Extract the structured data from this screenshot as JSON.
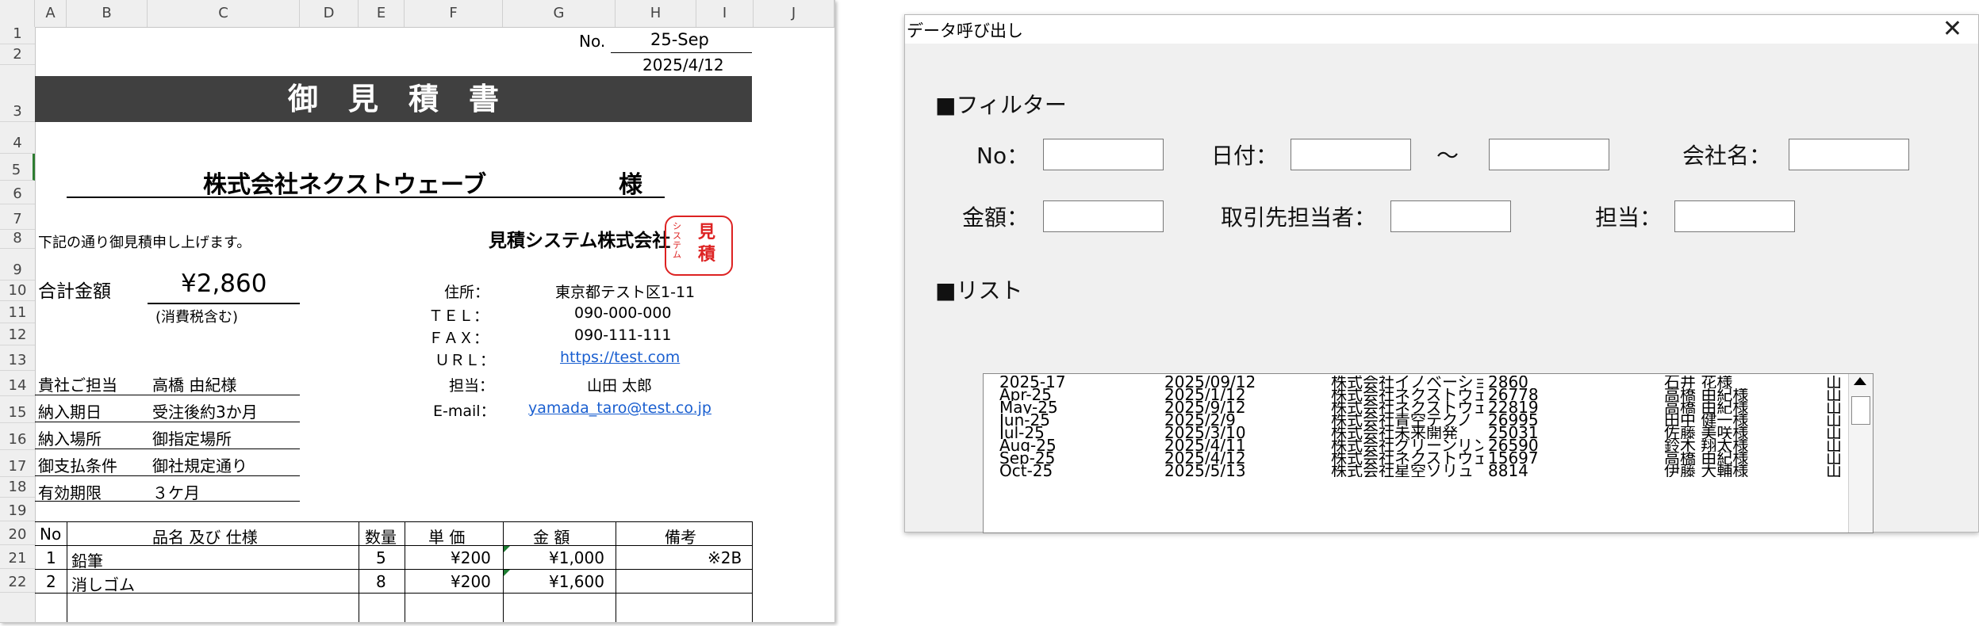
{
  "sheet": {
    "columns": [
      "A",
      "B",
      "C",
      "D",
      "E",
      "F",
      "G",
      "H",
      "I",
      "J"
    ],
    "rows": [
      "1",
      "2",
      "3",
      "4",
      "5",
      "6",
      "7",
      "8",
      "9",
      "10",
      "11",
      "12",
      "13",
      "14",
      "15",
      "16",
      "17",
      "18",
      "19",
      "20",
      "21",
      "22"
    ],
    "no_label": "No.",
    "no_value": "25-Sep",
    "date": "2025/4/12",
    "title": "御見積書",
    "customer": "株式会社ネクストウェーブ",
    "honorific": "様",
    "intro": "下記の通り御見積申し上げます。",
    "company": "見積システム株式会社",
    "stamp_small": "システム",
    "stamp_big": "見積",
    "total_label": "合計金額",
    "total_value": "¥2,860",
    "tax_note": "(消費税含む)",
    "contact": {
      "address_label": "住所：",
      "address": "東京都テスト区1-11",
      "tel_label": "ＴＥＬ：",
      "tel": "090-000-000",
      "fax_label": "ＦＡＸ：",
      "fax": "090-111-111",
      "url_label": "ＵＲＬ：",
      "url": "https://test.com",
      "person_label": "担当：",
      "person": "山田 太郎",
      "email_label": "E-mail：",
      "email": "yamada_taro@test.co.jp"
    },
    "info": [
      {
        "label": "貴社ご担当",
        "value": "高橋 由紀様"
      },
      {
        "label": "納入期日",
        "value": "受注後約3か月"
      },
      {
        "label": "納入場所",
        "value": "御指定場所"
      },
      {
        "label": "御支払条件",
        "value": "御社規定通り"
      },
      {
        "label": "有効期限",
        "value": "３ケ月"
      }
    ],
    "table_headers": {
      "no": "No",
      "item": "品名 及び 仕様",
      "qty": "数量",
      "price": "単 価",
      "amount": "金 額",
      "note": "備考"
    },
    "items": [
      {
        "no": "1",
        "name": "鉛筆",
        "qty": "5",
        "price": "¥200",
        "amount": "¥1,000",
        "note": "※2B"
      },
      {
        "no": "2",
        "name": "消しゴム",
        "qty": "8",
        "price": "¥200",
        "amount": "¥1,600",
        "note": ""
      }
    ]
  },
  "dialog": {
    "title": "データ呼び出し",
    "close": "✕",
    "filter_heading": "■フィルター",
    "list_heading": "■リスト",
    "labels": {
      "no": "No：",
      "date": "日付：",
      "tilde": "～",
      "company": "会社名：",
      "amount": "金額：",
      "client_person": "取引先担当者：",
      "person": "担当："
    },
    "inputs": {
      "no": "",
      "date_from": "",
      "date_to": "",
      "company": "",
      "amount": "",
      "client_person": "",
      "person": ""
    },
    "rows": [
      [
        "2025-17",
        "2025/09/12",
        "株式会社イノベーショ",
        "2860",
        "石井 花様",
        "山"
      ],
      [
        "Apr-25",
        "2025/1/12",
        "株式会社ネクストウェ",
        "26778",
        "高橋 由紀様",
        "山"
      ],
      [
        "May-25",
        "2025/9/12",
        "株式会社ネクストウェ",
        "22819",
        "高橋 由紀様",
        "山"
      ],
      [
        "Jun-25",
        "2025/2/9",
        "株式会社青空テクノ",
        "26995",
        "田中 健一様",
        "山"
      ],
      [
        "Jul-25",
        "2025/3/10",
        "株式会社未来開発",
        "25031",
        "佐藤 美咲様",
        "山"
      ],
      [
        "Aug-25",
        "2025/4/11",
        "株式会社グリーンリン",
        "26590",
        "鈴木 翔太様",
        "山"
      ],
      [
        "Sep-25",
        "2025/4/12",
        "株式会社ネクストウェ",
        "15697",
        "高橋 由紀様",
        "山"
      ],
      [
        "Oct-25",
        "2025/5/13",
        "株式会社星空ソリュ",
        "8814",
        "伊藤 大輔様",
        "山"
      ]
    ]
  }
}
